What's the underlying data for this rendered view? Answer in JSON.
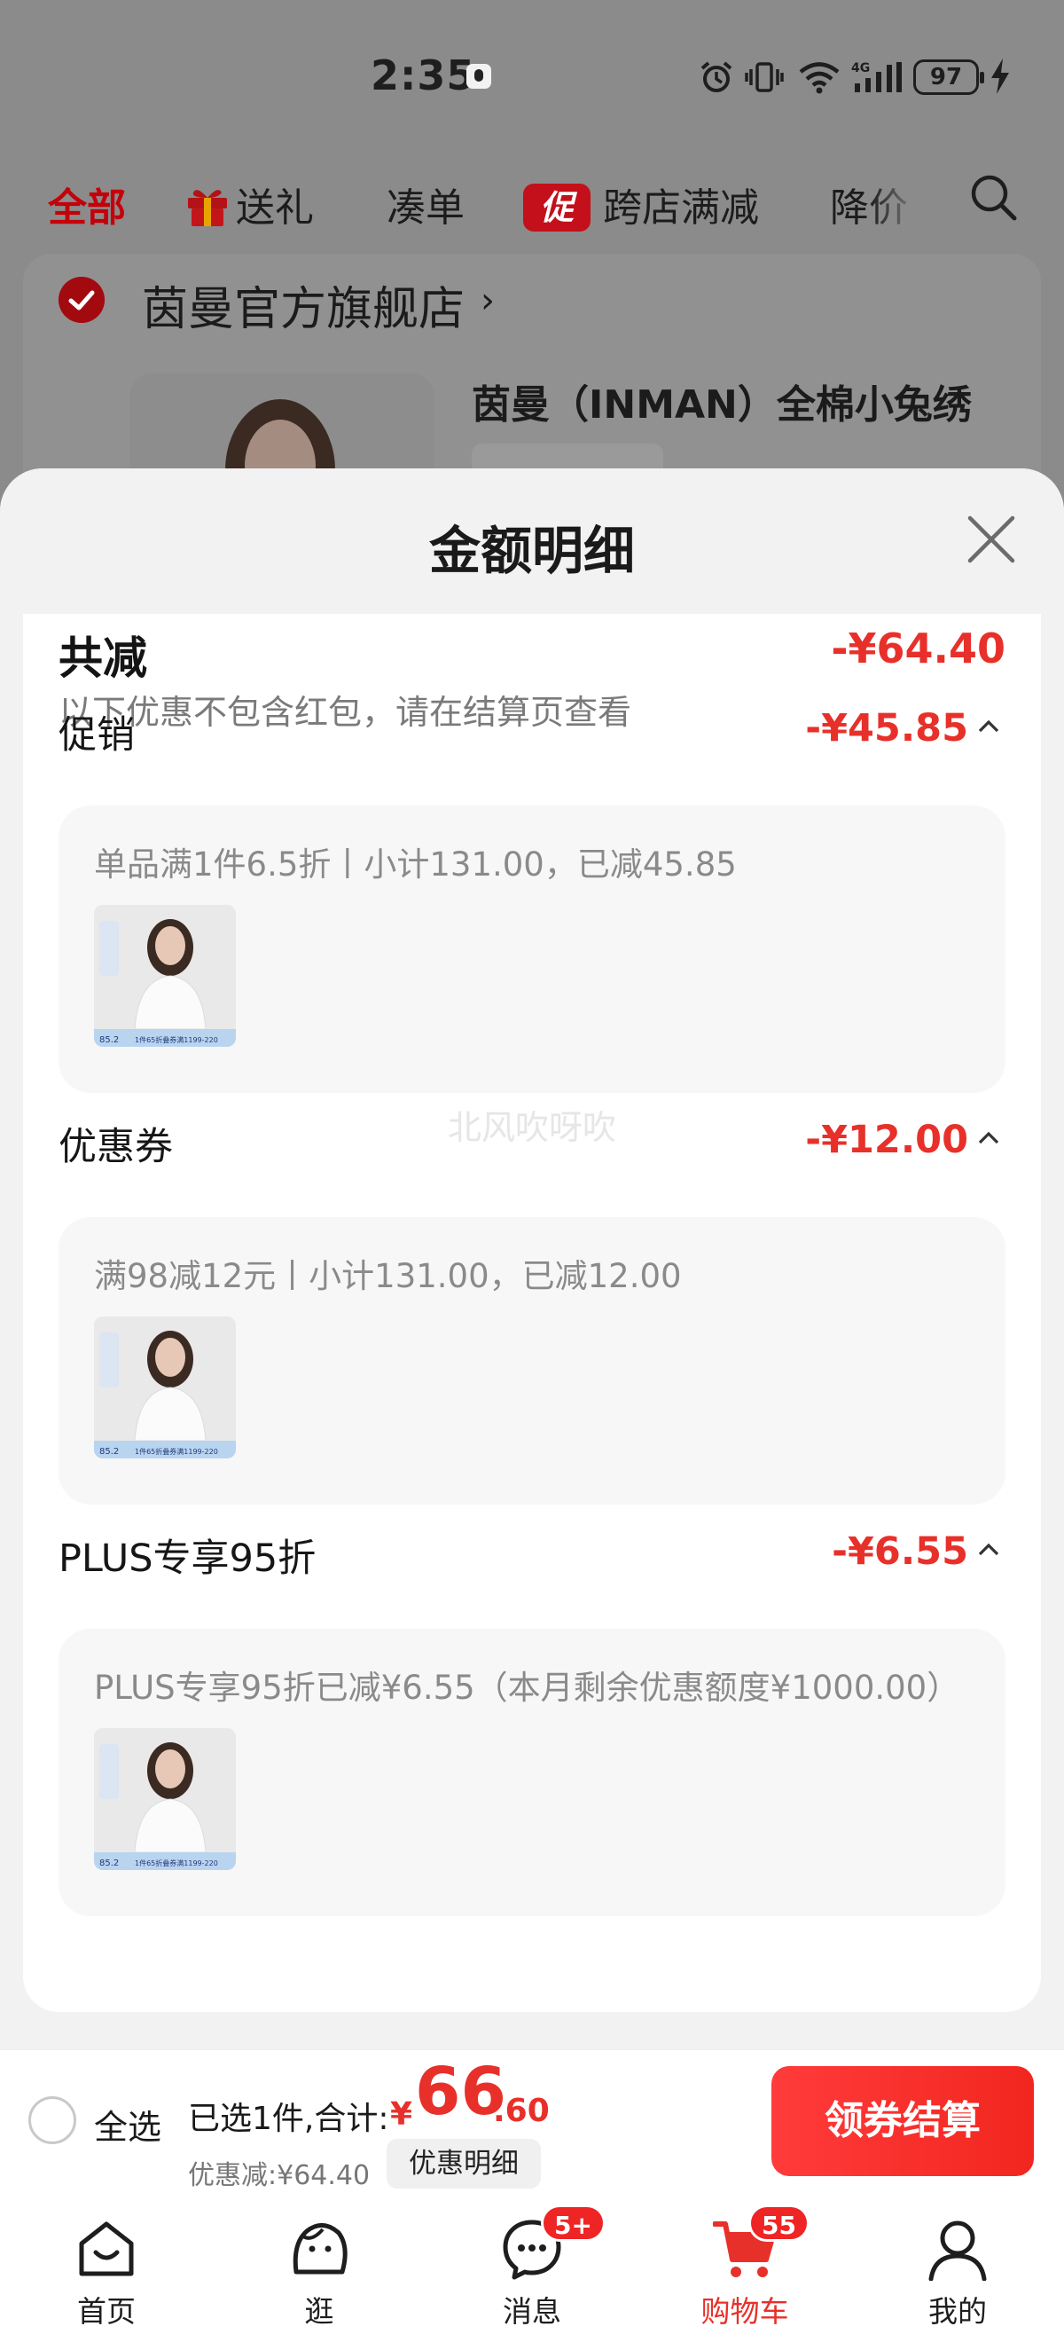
{
  "status_bar": {
    "time": "2:35",
    "battery": "97"
  },
  "filter_tabs": {
    "all": "全部",
    "gift": "送礼",
    "combine": "凑单",
    "cross_store_badge": "促",
    "cross_store": "跨店满减",
    "price_drop": "降价"
  },
  "store": {
    "name": "茵曼官方旗舰店",
    "chevron": "›",
    "product_title": "茵曼（INMAN）全棉小兔绣"
  },
  "sheet": {
    "title": "金额明细",
    "total_label": "共减",
    "total_amount": "-¥64.40",
    "total_note": "以下优惠不包含红包，请在结算页查看",
    "watermark": "北风吹呀吹",
    "sections": [
      {
        "title": "促销",
        "amount": "-¥45.85",
        "desc": "单品满1件6.5折丨小计131.00，已减45.85",
        "thumb_price": "85.2",
        "thumb_promo": "1件65折叠券满1199-220"
      },
      {
        "title": "优惠券",
        "amount": "-¥12.00",
        "desc": "满98减12元丨小计131.00，已减12.00",
        "thumb_price": "85.2",
        "thumb_promo": "1件65折叠券满1199-220"
      },
      {
        "title": "PLUS专享95折",
        "amount": "-¥6.55",
        "desc": "PLUS专享95折已减¥6.55（本月剩余优惠额度¥1000.00）",
        "thumb_price": "85.2",
        "thumb_promo": "1件65折叠券满1199-220"
      }
    ]
  },
  "checkout": {
    "select_all": "全选",
    "selected_summary": "已选1件,合计:",
    "currency": "¥",
    "price_int": "66",
    "price_dec": ".60",
    "discount": "优惠减:¥64.40",
    "details_chip": "优惠明细",
    "checkout_button": "领券结算"
  },
  "nav": {
    "home": "首页",
    "browse": "逛",
    "messages": "消息",
    "messages_badge": "5+",
    "cart": "购物车",
    "cart_badge": "55",
    "me": "我的"
  },
  "colors": {
    "accent": "#e8302a",
    "tab_active": "#c4000a",
    "checkout_button": "#f2261f"
  }
}
